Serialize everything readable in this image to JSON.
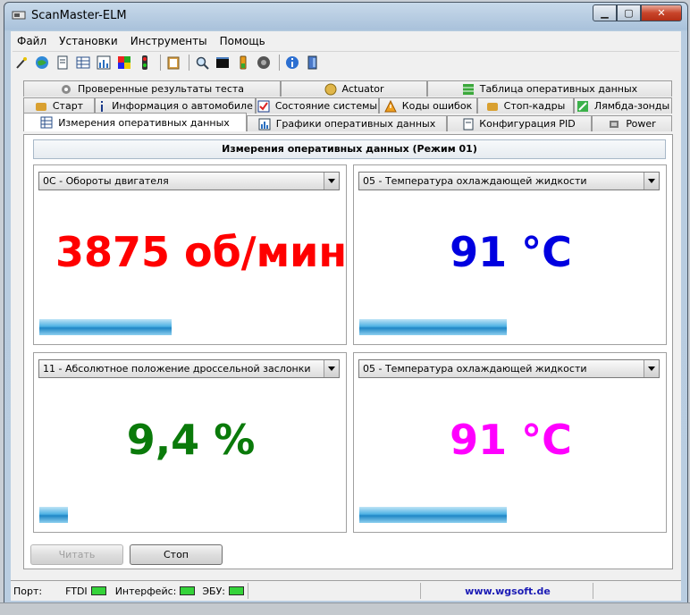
{
  "window": {
    "title": "ScanMaster-ELM"
  },
  "menu": [
    "Файл",
    "Установки",
    "Инструменты",
    "Помощь"
  ],
  "toolbar_icons": [
    "wand-icon",
    "globe-icon",
    "document-icon",
    "grid-icon",
    "chart-icon",
    "flag-icon",
    "traffic-light-icon",
    "clipboard-icon",
    "magnifier-icon",
    "terminal-icon",
    "battery-icon",
    "gauge-icon",
    "info-icon",
    "exit-icon"
  ],
  "tabs": {
    "row1": [
      {
        "label": "Проверенные результаты теста",
        "icon": "gear-icon"
      },
      {
        "label": "Actuator",
        "icon": "actuator-icon"
      },
      {
        "label": "Таблица оперативных данных",
        "icon": "table-icon"
      }
    ],
    "row2": [
      {
        "label": "Старт",
        "icon": "engine-icon"
      },
      {
        "label": "Информация о автомобиле",
        "icon": "info-icon"
      },
      {
        "label": "Состояние системы",
        "icon": "checkbox-icon"
      },
      {
        "label": "Коды ошибок",
        "icon": "warning-icon"
      },
      {
        "label": "Стоп-кадры",
        "icon": "engine-icon"
      },
      {
        "label": "Лямбда-зонды",
        "icon": "sensor-icon"
      }
    ],
    "row3": [
      {
        "label": "Измерения оперативных данных",
        "icon": "grid-icon",
        "active": true
      },
      {
        "label": "Графики оперативных данных",
        "icon": "chart-icon"
      },
      {
        "label": "Конфигурация PID",
        "icon": "document-icon"
      },
      {
        "label": "Power",
        "icon": "chip-icon"
      }
    ]
  },
  "panel": {
    "title": "Измерения оперативных данных (Режим 01)"
  },
  "gauges": [
    {
      "pid": "0C - Обороты двигателя",
      "value": "3875 об/мин",
      "color": "#ff0000",
      "level": 0.44
    },
    {
      "pid": "05 - Температура охлаждающей жидкости",
      "value": "91 °C",
      "color": "#0000e0",
      "level": 0.49
    },
    {
      "pid": "11 - Абсолютное положение дроссельной заслонки",
      "value": "9,4 %",
      "color": "#0a7a0a",
      "level": 0.094
    },
    {
      "pid": "05 - Температура охлаждающей жидкости",
      "value": "91 °C",
      "color": "#ff00ff",
      "level": 0.49
    }
  ],
  "buttons": {
    "read": "Читать",
    "stop": "Стоп"
  },
  "status": {
    "port_label": "Порт:",
    "port_value": "FTDI",
    "interface_label": "Интерфейс:",
    "ecu_label": "ЭБУ:",
    "website": "www.wgsoft.de",
    "led_color": "#35d33a"
  }
}
